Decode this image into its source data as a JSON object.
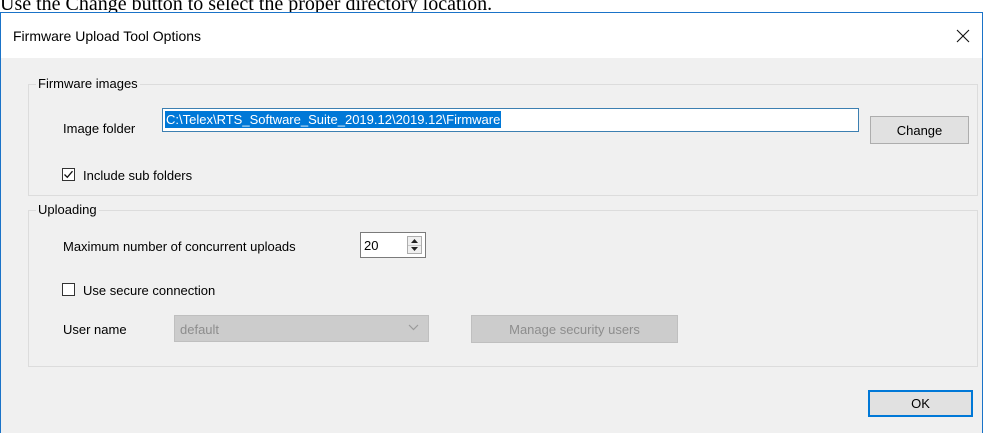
{
  "document": {
    "caption": "Use the Change button to select the proper directory location."
  },
  "window": {
    "title": "Firmware Upload Tool Options"
  },
  "firmware_images": {
    "group_label": "Firmware images",
    "image_folder_label": "Image folder",
    "image_folder_value": "C:\\Telex\\RTS_Software_Suite_2019.12\\2019.12\\Firmware",
    "change_label": "Change",
    "include_sub_folders_label": "Include sub folders",
    "include_sub_folders_checked": true
  },
  "uploading": {
    "group_label": "Uploading",
    "max_uploads_label": "Maximum number of concurrent uploads",
    "max_uploads_value": "20",
    "secure_connection_label": "Use secure connection",
    "secure_connection_checked": false,
    "user_name_label": "User name",
    "user_name_value": "default",
    "manage_users_label": "Manage security users"
  },
  "footer": {
    "ok_label": "OK"
  },
  "icons": {
    "close": "close-icon",
    "check": "checkmark-icon",
    "dropdown": "chevron-down-icon",
    "spin_up": "triangle-up-icon",
    "spin_down": "triangle-down-icon"
  },
  "colors": {
    "accent": "#0078d7",
    "window_border": "#1a73c8",
    "dialog_bg": "#f0f0f0",
    "disabled_bg": "#cccccc",
    "disabled_text": "#8d8d8d"
  }
}
